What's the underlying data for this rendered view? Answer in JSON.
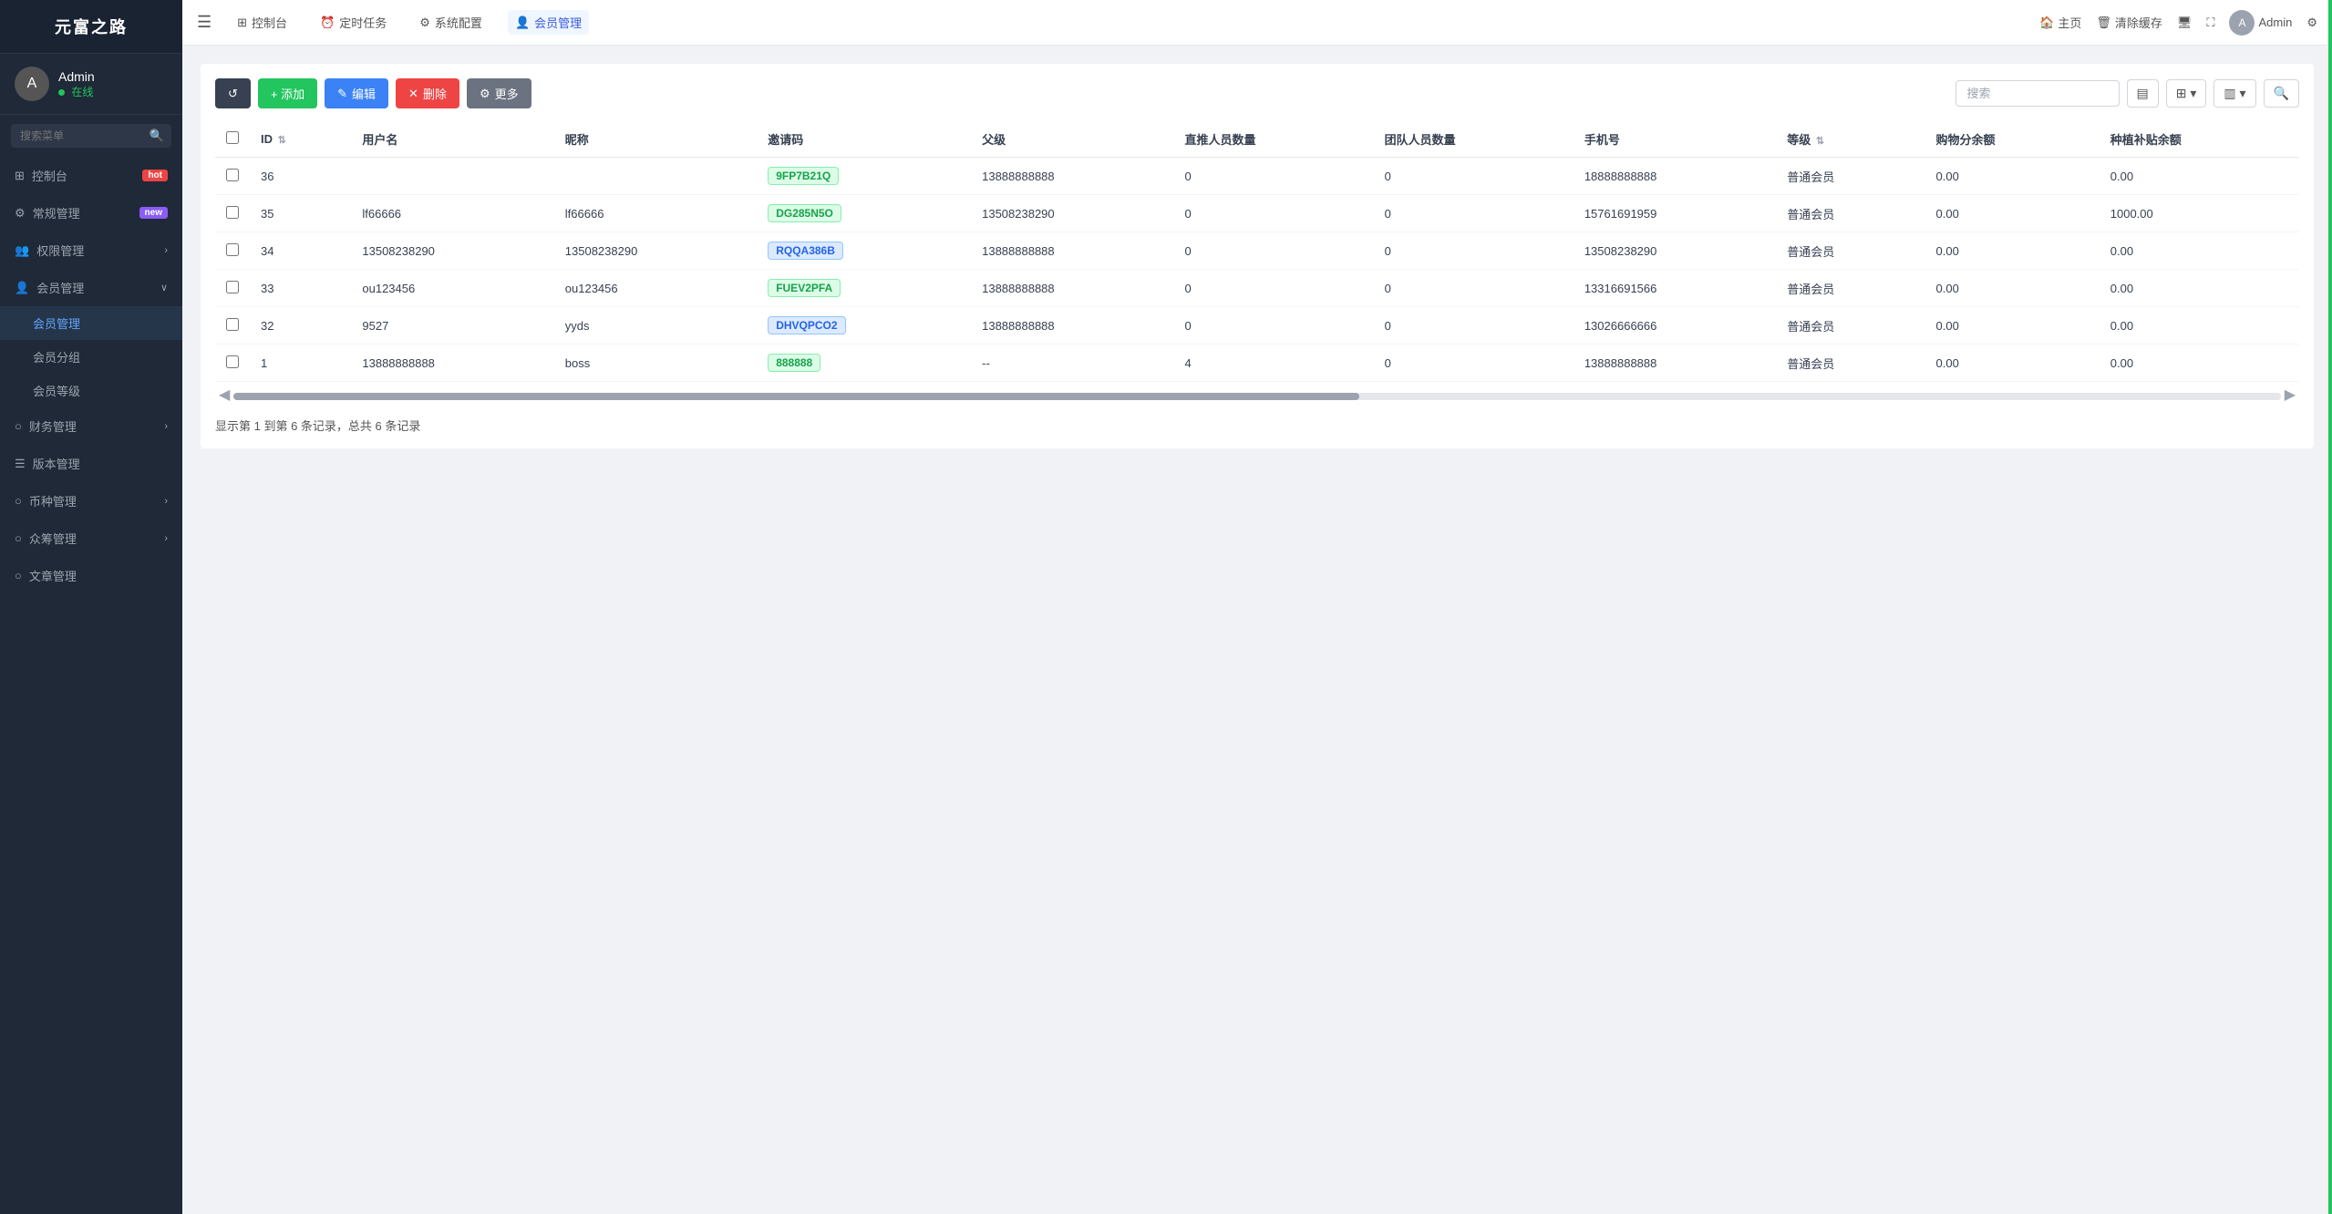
{
  "app": {
    "title": "元富之路"
  },
  "sidebar": {
    "user": {
      "name": "Admin",
      "status": "在线"
    },
    "search_placeholder": "搜索菜单",
    "items": [
      {
        "id": "dashboard",
        "label": "控制台",
        "badge": "hot",
        "icon": "grid-icon"
      },
      {
        "id": "general",
        "label": "常规管理",
        "badge": "new",
        "icon": "settings-icon"
      },
      {
        "id": "permissions",
        "label": "权限管理",
        "icon": "users-icon",
        "has_arrow": true
      },
      {
        "id": "members",
        "label": "会员管理",
        "icon": "person-icon",
        "has_arrow": true,
        "expanded": true,
        "sub_items": [
          {
            "id": "member-manage",
            "label": "会员管理",
            "active": true
          },
          {
            "id": "member-group",
            "label": "会员分组"
          },
          {
            "id": "member-level",
            "label": "会员等级"
          }
        ]
      },
      {
        "id": "finance",
        "label": "财务管理",
        "icon": "finance-icon",
        "has_arrow": true
      },
      {
        "id": "version",
        "label": "版本管理",
        "icon": "version-icon"
      },
      {
        "id": "currency",
        "label": "币种管理",
        "icon": "currency-icon",
        "has_arrow": true
      },
      {
        "id": "crowdfund",
        "label": "众筹管理",
        "icon": "crowdfund-icon",
        "has_arrow": true
      },
      {
        "id": "article",
        "label": "文章管理",
        "icon": "article-icon"
      }
    ]
  },
  "topnav": {
    "items": [
      {
        "id": "dashboard",
        "label": "控制台",
        "icon": "grid-icon"
      },
      {
        "id": "schedule",
        "label": "定时任务",
        "icon": "clock-icon"
      },
      {
        "id": "sysconfig",
        "label": "系统配置",
        "icon": "gear-icon"
      },
      {
        "id": "members",
        "label": "会员管理",
        "icon": "person-icon",
        "active": true
      }
    ],
    "right": {
      "home": "主页",
      "clear_cache": "清除缓存",
      "admin": "Admin"
    }
  },
  "toolbar": {
    "refresh_label": "↺",
    "add_label": "+ 添加",
    "edit_label": "✎ 编辑",
    "delete_label": "✕ 删除",
    "more_label": "⚙ 更多",
    "search_placeholder": "搜索"
  },
  "table": {
    "columns": [
      {
        "id": "id",
        "label": "ID",
        "sortable": true
      },
      {
        "id": "username",
        "label": "用户名"
      },
      {
        "id": "nickname",
        "label": "昵称"
      },
      {
        "id": "invite_code",
        "label": "邀请码"
      },
      {
        "id": "parent",
        "label": "父级"
      },
      {
        "id": "direct_count",
        "label": "直推人员数量"
      },
      {
        "id": "team_count",
        "label": "团队人员数量"
      },
      {
        "id": "phone",
        "label": "手机号"
      },
      {
        "id": "level",
        "label": "等级",
        "sortable": true
      },
      {
        "id": "shopping_balance",
        "label": "购物分余额"
      },
      {
        "id": "plant_balance",
        "label": "种植补贴余额"
      }
    ],
    "rows": [
      {
        "id": 36,
        "username": "",
        "nickname": "",
        "invite_code": "9FP7B21Q",
        "invite_code_type": "green",
        "parent": "13888888888",
        "direct_count": 0,
        "team_count": 0,
        "phone": "18888888888",
        "level": "普通会员",
        "shopping_balance": "0.00",
        "plant_balance": "0.00"
      },
      {
        "id": 35,
        "username": "lf66666",
        "nickname": "lf66666",
        "invite_code": "DG285N5O",
        "invite_code_type": "green",
        "parent": "13508238290",
        "direct_count": 0,
        "team_count": 0,
        "phone": "15761691959",
        "level": "普通会员",
        "shopping_balance": "0.00",
        "plant_balance": "1000.00"
      },
      {
        "id": 34,
        "username": "13508238290",
        "nickname": "13508238290",
        "invite_code": "RQQA386B",
        "invite_code_type": "blue",
        "parent": "13888888888",
        "direct_count": 0,
        "team_count": 0,
        "phone": "13508238290",
        "level": "普通会员",
        "shopping_balance": "0.00",
        "plant_balance": "0.00"
      },
      {
        "id": 33,
        "username": "ou123456",
        "nickname": "ou123456",
        "invite_code": "FUEV2PFA",
        "invite_code_type": "green",
        "parent": "13888888888",
        "direct_count": 0,
        "team_count": 0,
        "phone": "13316691566",
        "level": "普通会员",
        "shopping_balance": "0.00",
        "plant_balance": "0.00"
      },
      {
        "id": 32,
        "username": "9527",
        "nickname": "yyds",
        "invite_code": "DHVQPCO2",
        "invite_code_type": "blue",
        "parent": "13888888888",
        "direct_count": 0,
        "team_count": 0,
        "phone": "13026666666",
        "level": "普通会员",
        "shopping_balance": "0.00",
        "plant_balance": "0.00"
      },
      {
        "id": 1,
        "username": "13888888888",
        "nickname": "boss",
        "invite_code": "888888",
        "invite_code_type": "green",
        "parent": "--",
        "direct_count": 4,
        "team_count": 0,
        "phone": "13888888888",
        "level": "普通会员",
        "shopping_balance": "0.00",
        "plant_balance": "0.00"
      }
    ],
    "pagination_info": "显示第 1 到第 6 条记录，总共 6 条记录"
  }
}
